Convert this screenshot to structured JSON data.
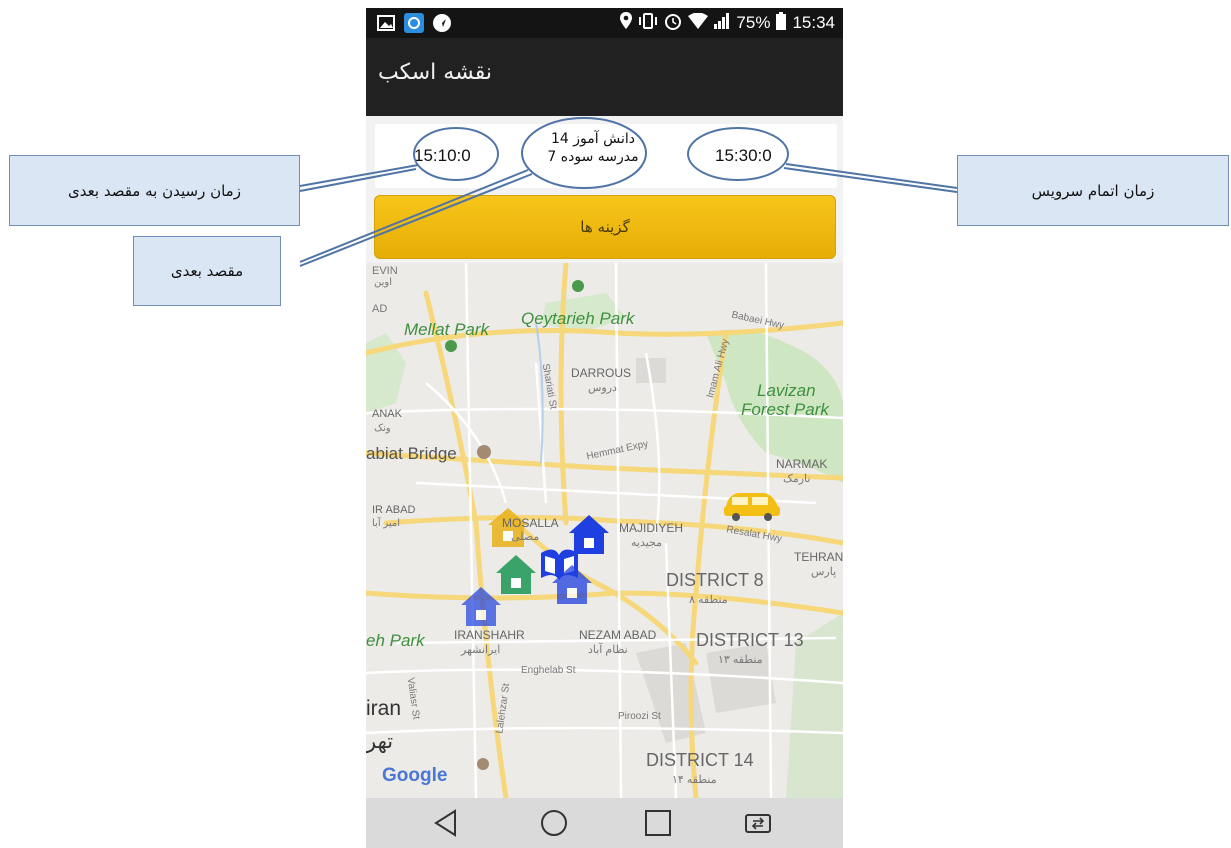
{
  "status_bar": {
    "battery": "75%",
    "time": "15:34"
  },
  "app_bar": {
    "title": "نقشه اسکب"
  },
  "info": {
    "arrival_time": "15:10:0",
    "destination_line1": "دانش آموز 14",
    "destination_line2": "مدرسه سوده 7",
    "service_end_time": "15:30:0"
  },
  "options_button": {
    "label": "گزینه ها"
  },
  "callouts": {
    "arrival": "زمان رسیدن به مقصد بعدی",
    "next_destination": "مقصد بعدی",
    "service_end": "زمان اتمام سرویس"
  },
  "map": {
    "attribution": "Google",
    "labels": {
      "evin": "EVIN",
      "evin_fa": "اوین",
      "ad": "AD",
      "mellat_park": "Mellat Park",
      "qeytarieh_park": "Qeytarieh Park",
      "babaei_hwy": "Babaei Hwy",
      "darrous": "DARROUS",
      "darrous_fa": "دروس",
      "shariati_st": "Shariati St",
      "imam_ali_hwy": "Imam Ali Hwy",
      "lavizan": "Lavizan",
      "forest_park": "Forest Park",
      "anak": "ANAK",
      "anak_fa": "ونک",
      "hemmat_expy": "Hemmat Expy",
      "tabiat_bridge": "abiat Bridge",
      "narmak": "NARMAK",
      "narmak_fa": "نارمک",
      "ir_abad": "IR ABAD",
      "ir_abad_fa": "امیر آبا",
      "mosalla": "MOSALLA",
      "mosalla_fa": "مصلی",
      "majidiyeh": "MAJIDIYEH",
      "majidiyeh_fa": "مجیدیه",
      "resalat_hwy": "Resalat Hwy",
      "tehran_pars": "TEHRAN",
      "tehran_pars_fa": "پارس",
      "district8": "DISTRICT 8",
      "district8_fa": "منطقه ۸",
      "eh_park": "eh Park",
      "iranshahr": "IRANSHAHR",
      "iranshahr_fa": "ایرانشهر",
      "nezam_abad": "NEZAM ABAD",
      "nezam_abad_fa": "نظام آباد",
      "district13": "DISTRICT 13",
      "district13_fa": "منطقه ۱۳",
      "enghelab_st": "Enghelab St",
      "valiasr_st": "Valiasr St",
      "lalehzar_st": "Lalehzar St",
      "iran": "iran",
      "tehran_fa": "تهر",
      "piroozi_st": "Piroozi St",
      "district14": "DISTRICT 14",
      "district14_fa": "منطقه ۱۴"
    }
  },
  "colors": {
    "app_bar": "#212121",
    "options_button": "#f4bf14",
    "callout_fill": "#dbe6f4",
    "callout_border": "#6f8fb5",
    "house_blue": "#1f3fe0",
    "house_green": "#3aa36a",
    "house_yellow": "#e8b21a"
  }
}
